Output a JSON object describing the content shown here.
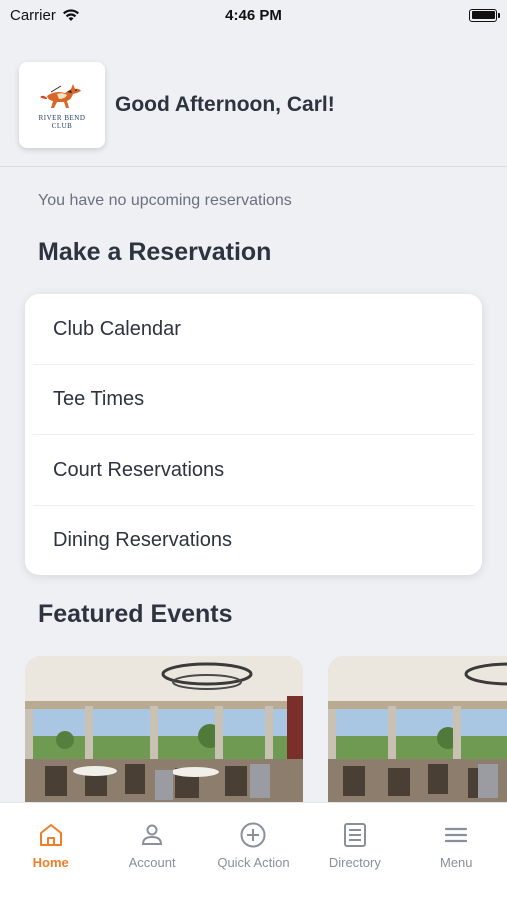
{
  "status_bar": {
    "carrier": "Carrier",
    "time": "4:46 PM"
  },
  "header": {
    "logo_text_line1": "RIVER BEND",
    "logo_text_line2": "CLUB",
    "greeting": "Good Afternoon, Carl!"
  },
  "reservations": {
    "empty_text": "You have no upcoming reservations"
  },
  "make_reservation": {
    "title": "Make a Reservation",
    "items": [
      {
        "label": "Club Calendar"
      },
      {
        "label": "Tee Times"
      },
      {
        "label": "Court Reservations"
      },
      {
        "label": "Dining Reservations"
      }
    ]
  },
  "featured_events": {
    "title": "Featured Events"
  },
  "tabbar": {
    "tabs": [
      {
        "label": "Home",
        "icon": "home-icon",
        "active": true
      },
      {
        "label": "Account",
        "icon": "person-icon",
        "active": false
      },
      {
        "label": "Quick Action",
        "icon": "plus-circle-icon",
        "active": false
      },
      {
        "label": "Directory",
        "icon": "list-icon",
        "active": false
      },
      {
        "label": "Menu",
        "icon": "hamburger-icon",
        "active": false
      }
    ],
    "active_color": "#f07e28",
    "inactive_color": "#8a8f9c"
  }
}
